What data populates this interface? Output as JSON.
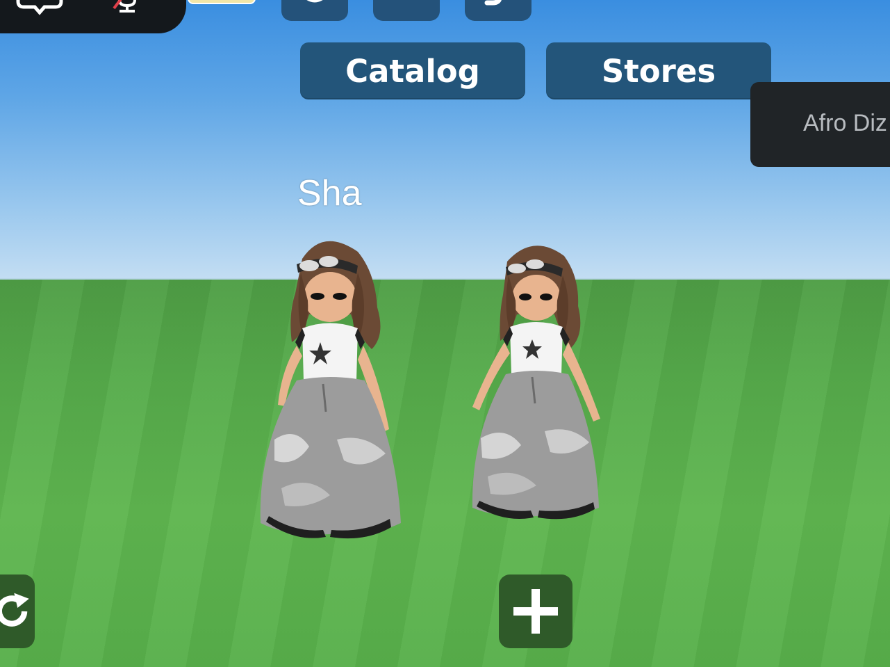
{
  "top_bar": {
    "icons": [
      "chat-icon",
      "microphone-muted-icon"
    ],
    "tabs_icons": [
      "history-icon",
      "list-icon",
      "shape-icon"
    ]
  },
  "navigation": {
    "catalog_label": "Catalog",
    "stores_label": "Stores"
  },
  "notification": {
    "text": "Afro Diz"
  },
  "scene": {
    "player_name": "Sha"
  },
  "bottom_controls": {
    "left_icon": "refresh-icon",
    "center_icon": "plus-icon"
  },
  "colors": {
    "button_blue": "#23557a",
    "notification_dark": "#202427",
    "control_green": "#2f5a29",
    "grass": "#5fb650",
    "sky": "#3a8ee0"
  }
}
